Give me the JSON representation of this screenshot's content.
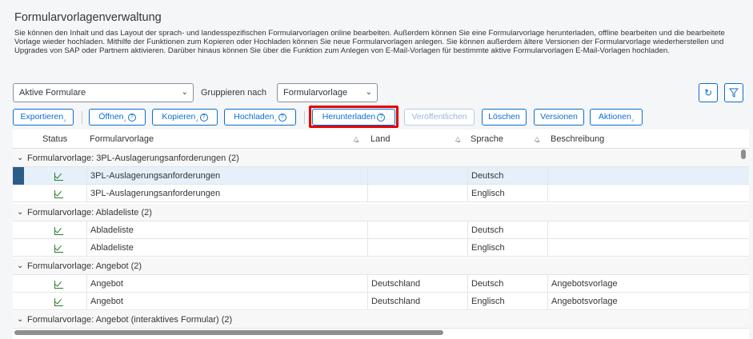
{
  "header": {
    "title": "Formularvorlagenverwaltung",
    "description": "Sie können den Inhalt und das Layout der sprach- und landesspezifischen Formularvorlagen online bearbeiten. Außerdem können Sie eine Formularvorlage herunterladen, offline bearbeiten und die bearbeitete Vorlage wieder hochladen. Mithilfe der Funktionen zum Kopieren oder Hochladen können Sie neue Formularvorlagen anlegen. Sie können außerdem ältere Versionen der Formularvorlage wiederherstellen und Upgrades von SAP oder Partnern aktivieren. Darüber hinaus können Sie über die Funktion zum Anlegen von E-Mail-Vorlagen für bestimmte aktive Formularvorlagen E-Mail-Vorlagen hochladen."
  },
  "filters": {
    "view_select": "Aktive Formulare",
    "group_by_label": "Gruppieren nach",
    "group_by_select": "Formularvorlage"
  },
  "toolbar": {
    "export": "Exportieren",
    "open": "Öffnen",
    "copy": "Kopieren",
    "upload": "Hochladen",
    "download": "Herunterladen",
    "publish": "Veröffentlichen",
    "delete": "Löschen",
    "versions": "Versionen",
    "actions": "Aktionen"
  },
  "icons": {
    "refresh": "refresh-icon",
    "filter": "filter-icon",
    "help": "help-icon",
    "check": "check-icon"
  },
  "colors": {
    "accent": "#0a6ed1",
    "highlight": "#e00000",
    "status_ok": "#2b7d2b"
  },
  "table": {
    "columns": {
      "status": "Status",
      "template": "Formularvorlage",
      "country": "Land",
      "language": "Sprache",
      "description": "Beschreibung"
    },
    "groups": [
      {
        "label": "Formularvorlage: 3PL-Auslagerungsanforderungen (2)",
        "rows": [
          {
            "template": "3PL-Auslagerungsanforderungen",
            "country": "",
            "language": "Deutsch",
            "description": ""
          },
          {
            "template": "3PL-Auslagerungsanforderungen",
            "country": "",
            "language": "Englisch",
            "description": ""
          }
        ]
      },
      {
        "label": "Formularvorlage: Abladeliste (2)",
        "rows": [
          {
            "template": "Abladeliste",
            "country": "",
            "language": "Deutsch",
            "description": ""
          },
          {
            "template": "Abladeliste",
            "country": "",
            "language": "Englisch",
            "description": ""
          }
        ]
      },
      {
        "label": "Formularvorlage: Angebot (2)",
        "rows": [
          {
            "template": "Angebot",
            "country": "Deutschland",
            "language": "Deutsch",
            "description": "Angebotsvorlage"
          },
          {
            "template": "Angebot",
            "country": "Deutschland",
            "language": "Englisch",
            "description": "Angebotsvorlage"
          }
        ]
      },
      {
        "label": "Formularvorlage: Angebot (interaktives Formular) (2)",
        "rows": []
      }
    ]
  }
}
